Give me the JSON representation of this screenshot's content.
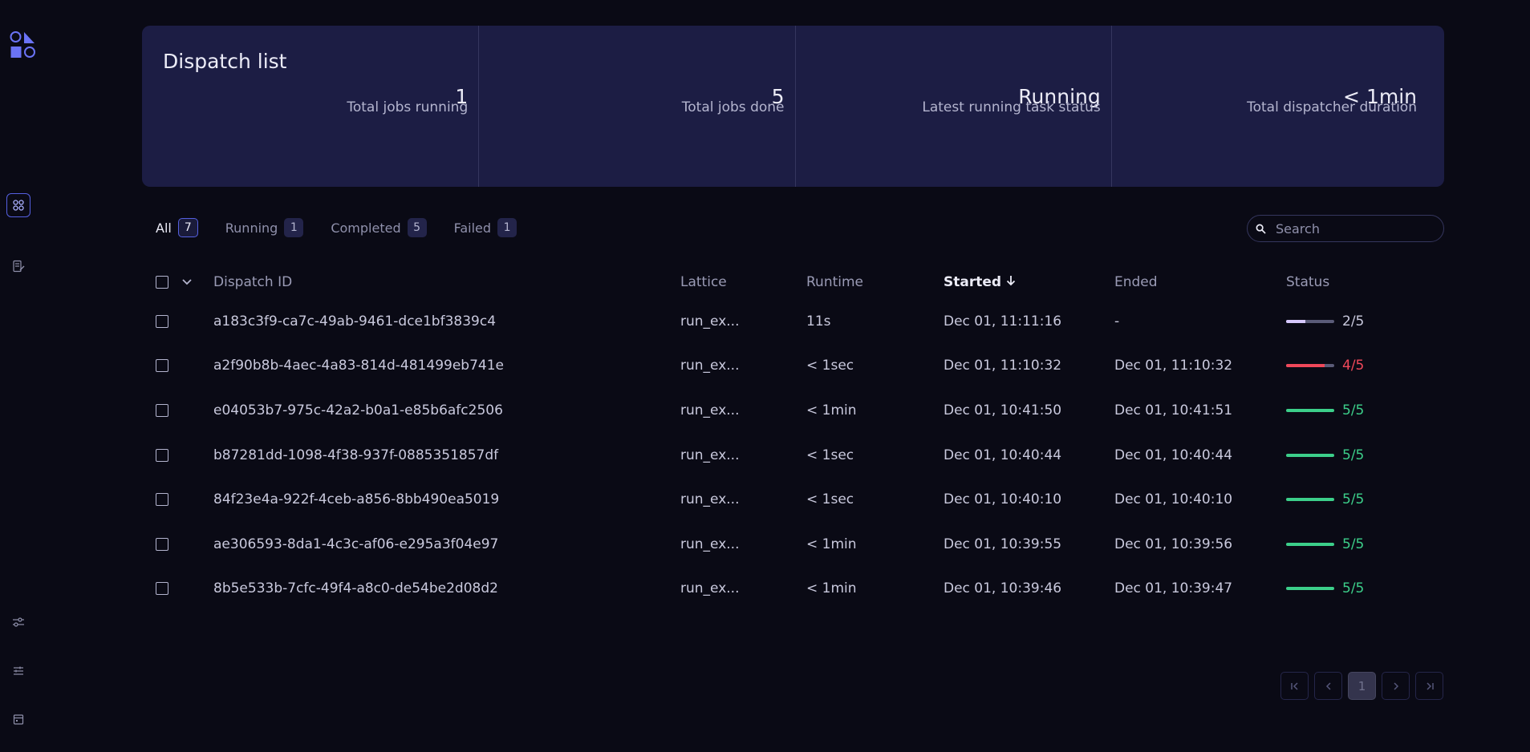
{
  "sidebar": {
    "icons": [
      "logo-icon",
      "dispatch-list-icon",
      "logs-icon",
      "settings-sliders-icon",
      "preferences-icon",
      "calendar-icon"
    ]
  },
  "summary": {
    "title": "Dispatch list",
    "stats": [
      {
        "value": "1",
        "label": "Total jobs running"
      },
      {
        "value": "5",
        "label": "Total jobs done"
      },
      {
        "value": "Running",
        "label": "Latest running task status"
      },
      {
        "value": "< 1min",
        "label": "Total dispatcher duration"
      }
    ]
  },
  "filters": {
    "tabs": [
      {
        "label": "All",
        "count": "7",
        "active": true
      },
      {
        "label": "Running",
        "count": "1",
        "active": false
      },
      {
        "label": "Completed",
        "count": "5",
        "active": false
      },
      {
        "label": "Failed",
        "count": "1",
        "active": false
      }
    ],
    "search_placeholder": "Search"
  },
  "table": {
    "columns": {
      "dispatch_id": "Dispatch ID",
      "lattice": "Lattice",
      "runtime": "Runtime",
      "started": "Started",
      "ended": "Ended",
      "status": "Status"
    },
    "sorted_column": "started",
    "rows": [
      {
        "id": "a183c3f9-ca7c-49ab-9461-dce1bf3839c4",
        "lattice": "run_ex...",
        "runtime": "11s",
        "started": "Dec 01, 11:11:16",
        "ended": "-",
        "status": "2/5",
        "progress": 0.4,
        "state": "running"
      },
      {
        "id": "a2f90b8b-4aec-4a83-814d-481499eb741e",
        "lattice": "run_ex...",
        "runtime": "< 1sec",
        "started": "Dec 01, 11:10:32",
        "ended": "Dec 01, 11:10:32",
        "status": "4/5",
        "progress": 0.8,
        "state": "failed"
      },
      {
        "id": "e04053b7-975c-42a2-b0a1-e85b6afc2506",
        "lattice": "run_ex...",
        "runtime": "< 1min",
        "started": "Dec 01, 10:41:50",
        "ended": "Dec 01, 10:41:51",
        "status": "5/5",
        "progress": 1.0,
        "state": "completed"
      },
      {
        "id": "b87281dd-1098-4f38-937f-0885351857df",
        "lattice": "run_ex...",
        "runtime": "< 1sec",
        "started": "Dec 01, 10:40:44",
        "ended": "Dec 01, 10:40:44",
        "status": "5/5",
        "progress": 1.0,
        "state": "completed"
      },
      {
        "id": "84f23e4a-922f-4ceb-a856-8bb490ea5019",
        "lattice": "run_ex...",
        "runtime": "< 1sec",
        "started": "Dec 01, 10:40:10",
        "ended": "Dec 01, 10:40:10",
        "status": "5/5",
        "progress": 1.0,
        "state": "completed"
      },
      {
        "id": "ae306593-8da1-4c3c-af06-e295a3f04e97",
        "lattice": "run_ex...",
        "runtime": "< 1min",
        "started": "Dec 01, 10:39:55",
        "ended": "Dec 01, 10:39:56",
        "status": "5/5",
        "progress": 1.0,
        "state": "completed"
      },
      {
        "id": "8b5e533b-7cfc-49f4-a8c0-de54be2d08d2",
        "lattice": "run_ex...",
        "runtime": "< 1min",
        "started": "Dec 01, 10:39:46",
        "ended": "Dec 01, 10:39:47",
        "status": "5/5",
        "progress": 1.0,
        "state": "completed"
      }
    ]
  },
  "state_colors": {
    "running": {
      "bar": "#d7c9ff",
      "text": "#c9c9dd"
    },
    "failed": {
      "bar": "#f0485a",
      "text": "#f0485a"
    },
    "completed": {
      "bar": "#3ccf8a",
      "text": "#3ccf8a"
    }
  },
  "pagination": {
    "current_page": "1"
  }
}
